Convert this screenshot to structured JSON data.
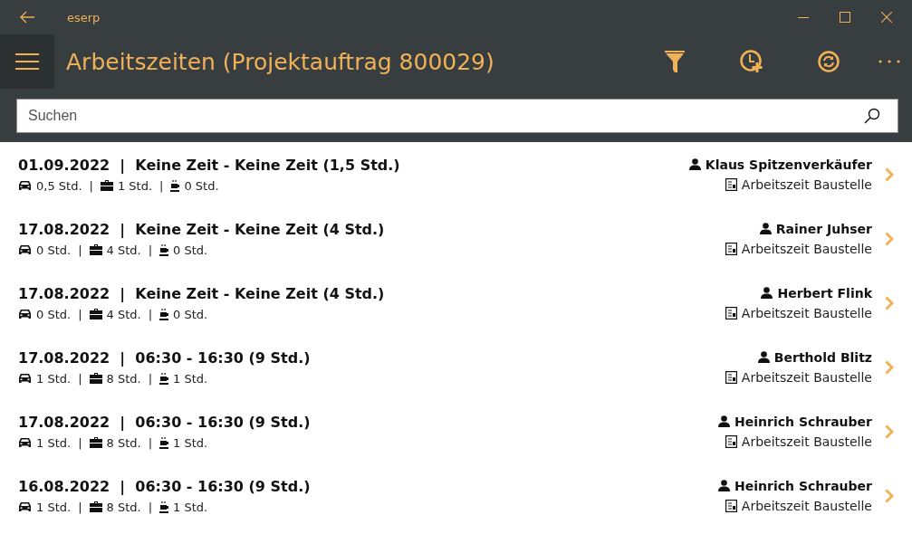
{
  "window": {
    "title": "eserp"
  },
  "header": {
    "title": "Arbeitszeiten (Projektauftrag 800029)"
  },
  "search": {
    "placeholder": "Suchen"
  },
  "entries": [
    {
      "title": "01.09.2022  |  Keine Zeit - Keine Zeit (1,5 Std.)",
      "meta": [
        {
          "kind": "drive",
          "text": "0,5 Std."
        },
        {
          "kind": "separator",
          "text": "|"
        },
        {
          "kind": "work",
          "text": "1 Std."
        },
        {
          "kind": "separator",
          "text": "|"
        },
        {
          "kind": "break",
          "text": "0 Std."
        }
      ],
      "person": "Klaus Spitzenverkäufer",
      "type": "Arbeitszeit Baustelle"
    },
    {
      "title": "17.08.2022  |  Keine Zeit - Keine Zeit (4 Std.)",
      "meta": [
        {
          "kind": "drive",
          "text": "0 Std."
        },
        {
          "kind": "separator",
          "text": "|"
        },
        {
          "kind": "work",
          "text": "4 Std."
        },
        {
          "kind": "separator",
          "text": "|"
        },
        {
          "kind": "break",
          "text": "0 Std."
        }
      ],
      "person": "Rainer Juhser",
      "type": "Arbeitszeit Baustelle"
    },
    {
      "title": "17.08.2022  |  Keine Zeit - Keine Zeit (4 Std.)",
      "meta": [
        {
          "kind": "drive",
          "text": "0 Std."
        },
        {
          "kind": "separator",
          "text": "|"
        },
        {
          "kind": "work",
          "text": "4 Std."
        },
        {
          "kind": "separator",
          "text": "|"
        },
        {
          "kind": "break",
          "text": "0 Std."
        }
      ],
      "person": "Herbert Flink",
      "type": "Arbeitszeit Baustelle"
    },
    {
      "title": "17.08.2022  |  06:30 - 16:30 (9 Std.)",
      "meta": [
        {
          "kind": "drive",
          "text": "1 Std."
        },
        {
          "kind": "separator",
          "text": "|"
        },
        {
          "kind": "work",
          "text": "8 Std."
        },
        {
          "kind": "separator",
          "text": "|"
        },
        {
          "kind": "break",
          "text": "1 Std."
        }
      ],
      "person": "Berthold Blitz",
      "type": "Arbeitszeit Baustelle"
    },
    {
      "title": "17.08.2022  |  06:30 - 16:30 (9 Std.)",
      "meta": [
        {
          "kind": "drive",
          "text": "1 Std."
        },
        {
          "kind": "separator",
          "text": "|"
        },
        {
          "kind": "work",
          "text": "8 Std."
        },
        {
          "kind": "separator",
          "text": "|"
        },
        {
          "kind": "break",
          "text": "1 Std."
        }
      ],
      "person": "Heinrich Schrauber",
      "type": "Arbeitszeit Baustelle"
    },
    {
      "title": "16.08.2022  |  06:30 - 16:30 (9 Std.)",
      "meta": [
        {
          "kind": "drive",
          "text": "1 Std."
        },
        {
          "kind": "separator",
          "text": "|"
        },
        {
          "kind": "work",
          "text": "8 Std."
        },
        {
          "kind": "separator",
          "text": "|"
        },
        {
          "kind": "break",
          "text": "1 Std."
        }
      ],
      "person": "Heinrich Schrauber",
      "type": "Arbeitszeit Baustelle"
    }
  ]
}
